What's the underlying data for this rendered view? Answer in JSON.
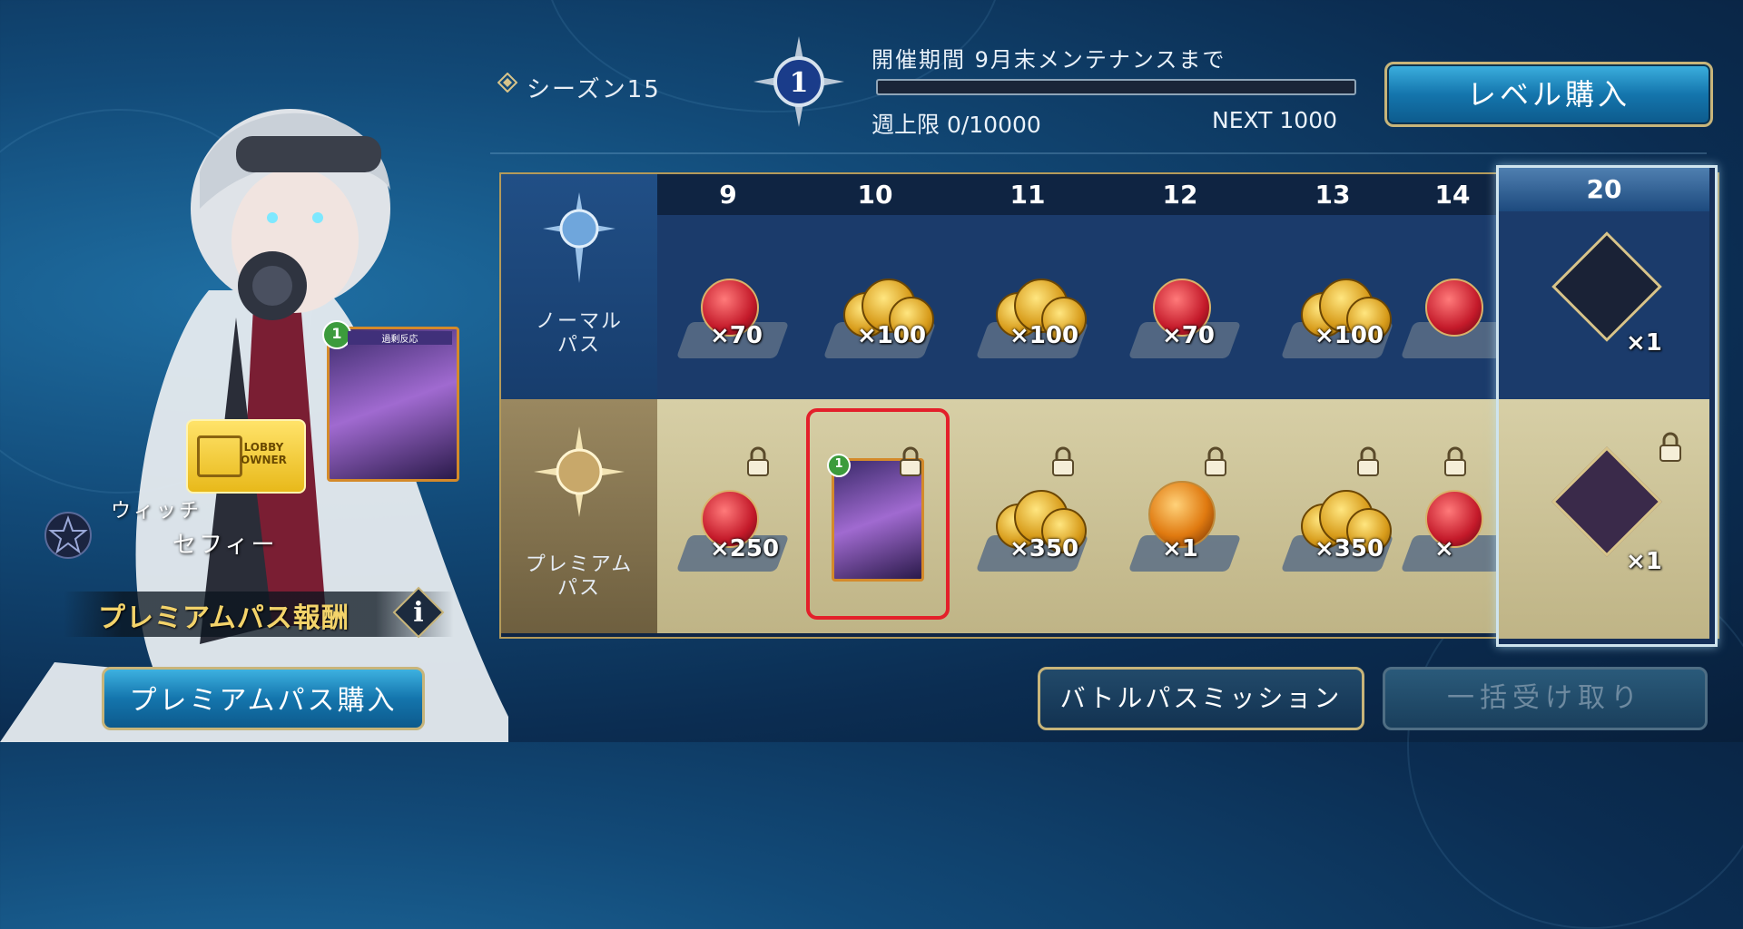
{
  "season": {
    "label": "シーズン15",
    "level": "1"
  },
  "event": {
    "period": "開催期間 9月末メンテナンスまで",
    "weekly_limit": "週上限 0/10000",
    "next": "NEXT 1000",
    "progress": 0
  },
  "buttons": {
    "level_purchase": "レベル購入",
    "premium_purchase": "プレミアムパス購入",
    "battle_pass_mission": "バトルパスミッション",
    "claim_all": "一括受け取り"
  },
  "rows": {
    "normal": "ノーマル\nパス",
    "premium": "プレミアム\nパス"
  },
  "columns": [
    {
      "level": "9",
      "normal": {
        "item": "potion",
        "qty": "×70"
      },
      "premium": {
        "item": "potion",
        "qty": "×250",
        "locked": true
      }
    },
    {
      "level": "10",
      "normal": {
        "item": "coins",
        "qty": "×100"
      },
      "premium": {
        "item": "card",
        "qty": "",
        "locked": true
      }
    },
    {
      "level": "11",
      "normal": {
        "item": "coins",
        "qty": "×100"
      },
      "premium": {
        "item": "coins",
        "qty": "×350",
        "locked": true
      }
    },
    {
      "level": "12",
      "normal": {
        "item": "potion",
        "qty": "×70"
      },
      "premium": {
        "item": "orb",
        "qty": "×1",
        "locked": true
      }
    },
    {
      "level": "13",
      "normal": {
        "item": "coins",
        "qty": "×100"
      },
      "premium": {
        "item": "coins",
        "qty": "×350",
        "locked": true
      }
    },
    {
      "level": "14",
      "normal": {
        "item": "potion",
        "qty": ""
      },
      "premium": {
        "item": "potion",
        "qty": "×",
        "locked": true
      }
    }
  ],
  "featured": {
    "level": "20",
    "normal_qty": "×1",
    "premium_qty": "×1"
  },
  "character": {
    "class": "ウィッチ",
    "name": "セフィー",
    "lobby_badge": "LOBBY\nOWNER",
    "card_title": "過剰反応",
    "card_cost": "1"
  },
  "premium_rewards_title": "プレミアムパス報酬",
  "info_icon_label": "i",
  "colors": {
    "gold": "#c8b57a",
    "highlight": "#e3202a",
    "premium_bg": "#d7cfa6",
    "normal_bg": "#1b3b6b"
  }
}
